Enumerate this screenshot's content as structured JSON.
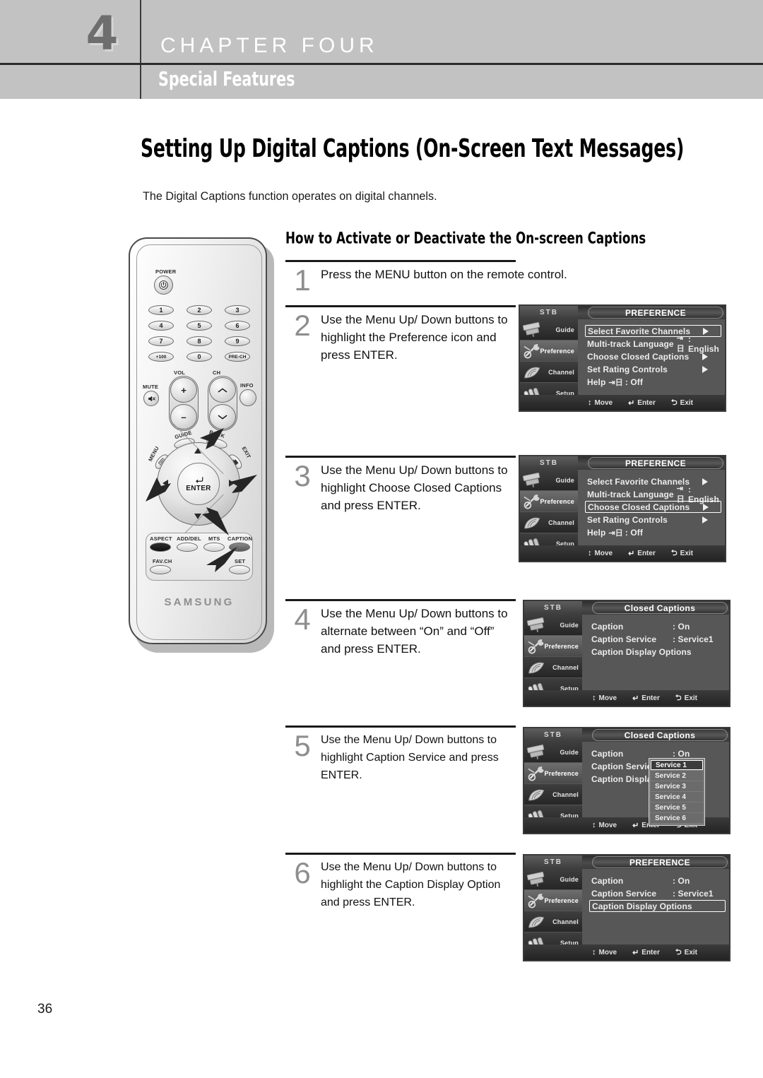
{
  "header": {
    "chapter_number": "4",
    "chapter_label": "CHAPTER FOUR",
    "chapter_subtitle": "Special Features"
  },
  "page_title": "Setting Up Digital Captions (On-Screen Text Messages)",
  "intro_paragraph": "The Digital Captions function operates on digital channels.",
  "section_heading": "How to Activate or Deactivate the On-screen Captions",
  "page_number": "36",
  "steps": [
    {
      "num": "1",
      "text": "Press the MENU button on the remote control."
    },
    {
      "num": "2",
      "text": "Use the Menu Up/ Down buttons to highlight the Preference icon and press ENTER."
    },
    {
      "num": "3",
      "text": "Use the Menu Up/ Down buttons to highlight Choose Closed Captions and press ENTER."
    },
    {
      "num": "4",
      "text": "Use the Menu Up/ Down buttons to alternate between “On” and “Off” and press ENTER."
    },
    {
      "num": "5",
      "text": "Use the Menu Up/ Down buttons to highlight Caption Service and press ENTER."
    },
    {
      "num": "6",
      "text": "Use the Menu Up/ Down buttons to highlight the Caption Display Option and press ENTER."
    }
  ],
  "remote": {
    "brand": "SAMSUNG",
    "power_label": "POWER",
    "power_glyph": "⏻/I",
    "numpad": [
      "1",
      "2",
      "3",
      "4",
      "5",
      "6",
      "7",
      "8",
      "9",
      "+100",
      "0",
      "PRE-CH"
    ],
    "vol_label": "VOL",
    "ch_label": "CH",
    "mute_label": "MUTE",
    "info_label": "INFO",
    "vol_up": "+",
    "vol_down": "–",
    "guide_label": "GUIDE",
    "back_label": "BACK",
    "menu_label": "MENU",
    "exit_label": "EXIT",
    "enter_label": "ENTER",
    "function_row1": [
      "ASPECT",
      "ADD/DEL",
      "MTS",
      "CAPTION"
    ],
    "function_row2": [
      "FAV.CH",
      "SET"
    ]
  },
  "osd": {
    "stb_label": "STB",
    "sidebar": [
      {
        "label": "Guide",
        "icon": "program-guide-icon"
      },
      {
        "label": "Preference",
        "icon": "wrench-icon"
      },
      {
        "label": "Channel",
        "icon": "satellite-dish-icon"
      },
      {
        "label": "Setup",
        "icon": "tools-icon"
      }
    ],
    "hints": [
      {
        "glyph": "↕",
        "label": "Move"
      },
      {
        "glyph": "↵",
        "label": "Enter"
      },
      {
        "glyph": "⮌",
        "label": "Exit"
      }
    ],
    "screens": [
      {
        "id": "preference-1",
        "title": "PREFERENCE",
        "rows": [
          {
            "label": "Select Favorite Channels",
            "value": "",
            "arrow": true,
            "selected": true,
            "langicon": false
          },
          {
            "label": "Multi-track Language",
            "value": ": English",
            "arrow": false,
            "selected": false,
            "langicon": true
          },
          {
            "label": "Choose Closed Captions",
            "value": "",
            "arrow": true,
            "selected": false,
            "langicon": false
          },
          {
            "label": "Set Rating Controls",
            "value": "",
            "arrow": true,
            "selected": false,
            "langicon": false
          },
          {
            "label": "Help",
            "value": ": Off",
            "arrow": false,
            "selected": false,
            "langicon": true
          }
        ]
      },
      {
        "id": "preference-2",
        "title": "PREFERENCE",
        "rows": [
          {
            "label": "Select Favorite Channels",
            "value": "",
            "arrow": true,
            "selected": false,
            "langicon": false
          },
          {
            "label": "Multi-track Language",
            "value": ": English",
            "arrow": false,
            "selected": false,
            "langicon": true
          },
          {
            "label": "Choose Closed Captions",
            "value": "",
            "arrow": true,
            "selected": true,
            "langicon": false
          },
          {
            "label": "Set Rating Controls",
            "value": "",
            "arrow": true,
            "selected": false,
            "langicon": false
          },
          {
            "label": "Help",
            "value": ": Off",
            "arrow": false,
            "selected": false,
            "langicon": true
          }
        ]
      },
      {
        "id": "closed-captions-1",
        "title": "Closed Captions",
        "rows": [
          {
            "label": "Caption",
            "value": ": On",
            "arrow": false,
            "selected": false,
            "langicon": false
          },
          {
            "label": "Caption Service",
            "value": ": Service1",
            "arrow": false,
            "selected": false,
            "langicon": false
          },
          {
            "label": "Caption Display Options",
            "value": "",
            "arrow": false,
            "selected": false,
            "langicon": false
          }
        ]
      },
      {
        "id": "closed-captions-2",
        "title": "Closed Captions",
        "rows": [
          {
            "label": "Caption",
            "value": ": On",
            "arrow": false,
            "selected": false,
            "langicon": false
          },
          {
            "label": "Caption Service",
            "value": ":",
            "arrow": false,
            "selected": false,
            "langicon": false
          },
          {
            "label": "Caption Display Optio",
            "value": "",
            "arrow": false,
            "selected": false,
            "langicon": false
          }
        ],
        "dropdown": [
          "Service 1",
          "Service 2",
          "Service 3",
          "Service 4",
          "Service 5",
          "Service 6"
        ],
        "dropdown_selected": 0
      },
      {
        "id": "preference-3",
        "title": "PREFERENCE",
        "rows": [
          {
            "label": "Caption",
            "value": ": On",
            "arrow": false,
            "selected": false,
            "langicon": false
          },
          {
            "label": "Caption Service",
            "value": ": Service1",
            "arrow": false,
            "selected": false,
            "langicon": false
          },
          {
            "label": "Caption Display Options",
            "value": "",
            "arrow": false,
            "selected": true,
            "langicon": false
          }
        ]
      }
    ]
  },
  "colors": {
    "header_gray": "#c2c2c2",
    "rule_dark": "#2b2b2b",
    "step_number_gray": "#8e8e8e",
    "osd_bg": "#575757",
    "osd_chrome": "#2a2a2a"
  }
}
